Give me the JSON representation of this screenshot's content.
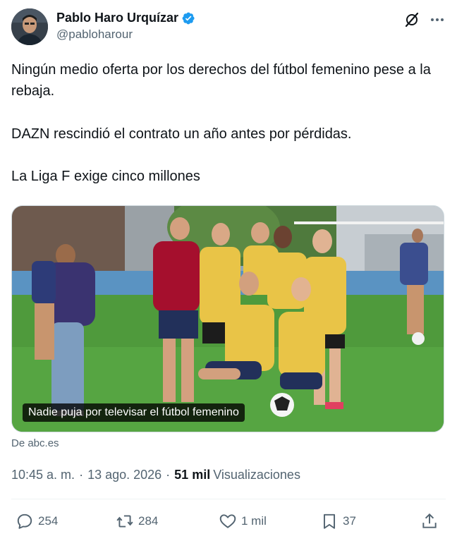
{
  "author": {
    "display_name": "Pablo Haro Urquízar",
    "handle": "@pabloharour"
  },
  "tweet": {
    "paragraphs": [
      "Ningún medio oferta por los derechos del fútbol femenino pese a la rebaja.",
      "DAZN rescindió el contrato un año antes por pérdidas.",
      "La Liga F exige cinco millones"
    ]
  },
  "card": {
    "caption": "Nadie puja por televisar el fútbol femenino",
    "source": "De abc.es"
  },
  "meta": {
    "time": "10:45 a. m.",
    "sep1": "·",
    "date": "13 ago. 2026",
    "sep2": "·",
    "views_count": "51 mil",
    "views_label": "Visualizaciones"
  },
  "actions": {
    "replies": "254",
    "reposts": "284",
    "likes": "1 mil",
    "bookmarks": "37"
  },
  "colors": {
    "verified": "#1d9bf0",
    "secondary_text": "#536471",
    "primary_text": "#0f1419"
  },
  "icons": [
    "verified-badge-icon",
    "grok-icon",
    "more-icon",
    "reply-icon",
    "repost-icon",
    "like-icon",
    "bookmark-icon",
    "share-icon"
  ]
}
